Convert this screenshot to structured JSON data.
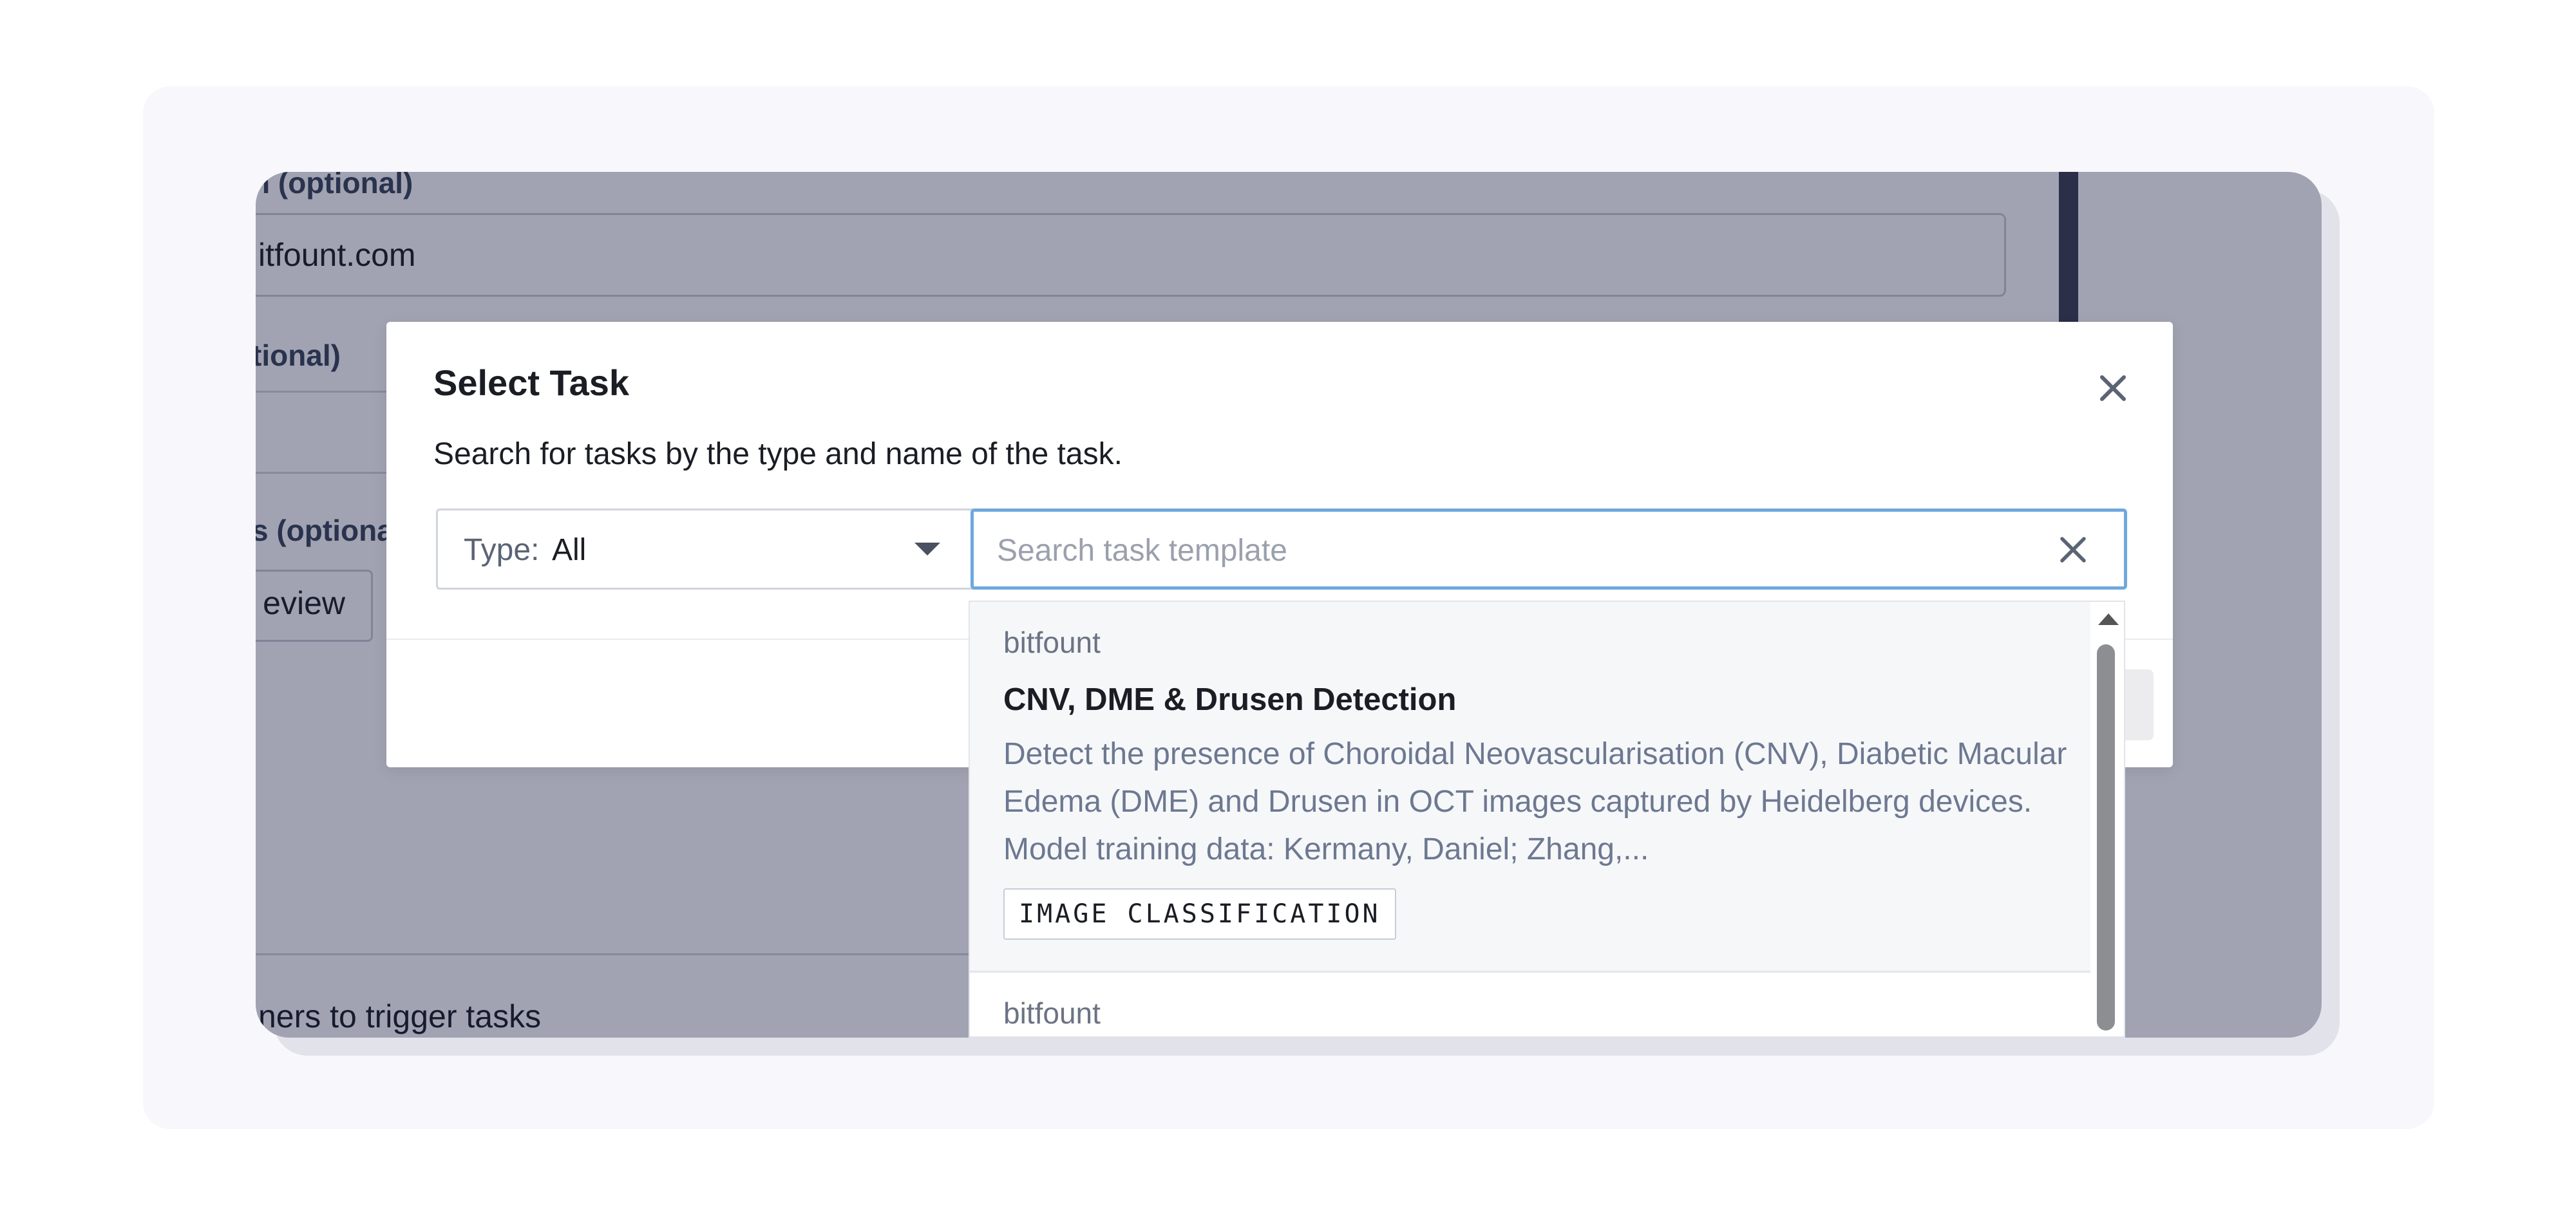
{
  "background_form": {
    "field1_label": "n (optional)",
    "field1_value": "itfount.com",
    "field2_label": "tional)",
    "field3_label": "s (optiona",
    "review_button": "eview",
    "trigger_text": "ners to trigger tasks"
  },
  "modal": {
    "title": "Select Task",
    "description": "Search for tasks by the type and name of the task.",
    "close_icon": "close-icon",
    "type_filter": {
      "prefix": "Type:",
      "value": "All"
    },
    "search": {
      "placeholder": "Search task template",
      "value": ""
    }
  },
  "dropdown": {
    "options": [
      {
        "owner": "bitfount",
        "name": "CNV, DME & Drusen Detection",
        "description": "Detect the presence of Choroidal Neovascularisation (CNV), Diabetic Macular Edema (DME) and Drusen in OCT images captured by Heidelberg devices. Model training data: Kermany, Daniel; Zhang,...",
        "tag": "IMAGE CLASSIFICATION"
      },
      {
        "owner": "bitfount"
      }
    ]
  },
  "colors": {
    "overlay": "#14183e",
    "search_focus_border": "#6fa8dc",
    "description_text": "#6d7891"
  }
}
